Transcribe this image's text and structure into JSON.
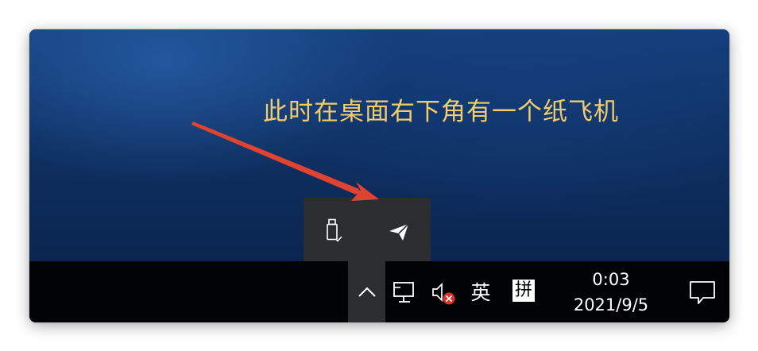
{
  "annotation": {
    "caption": "此时在桌面右下角有一个纸飞机",
    "caption_color": "#f3cc6b",
    "arrow_color": "#e0432f"
  },
  "tray_popup": {
    "icons": [
      "usb-drive-icon",
      "paper-plane-icon"
    ]
  },
  "taskbar": {
    "chevron": "^",
    "ime_language": "英",
    "ime_mode": "拼",
    "clock_time": "0:03",
    "clock_date": "2021/9/5"
  },
  "colors": {
    "desktop": "#0f3163",
    "taskbar": "#020304",
    "popup": "#2b2d31",
    "muted_badge": "#e0302a"
  }
}
